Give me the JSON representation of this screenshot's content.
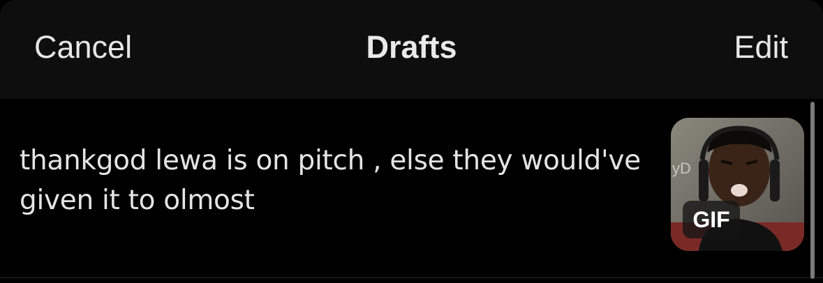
{
  "header": {
    "cancel_label": "Cancel",
    "title": "Drafts",
    "edit_label": "Edit"
  },
  "drafts": [
    {
      "text": "thankgod lewa is on pitch , else they would've given it to olmost",
      "media": {
        "type": "gif",
        "badge_label": "GIF"
      }
    }
  ],
  "colors": {
    "background": "#000000",
    "header_background": "#0e0e0e",
    "text": "#e4e4e4"
  }
}
